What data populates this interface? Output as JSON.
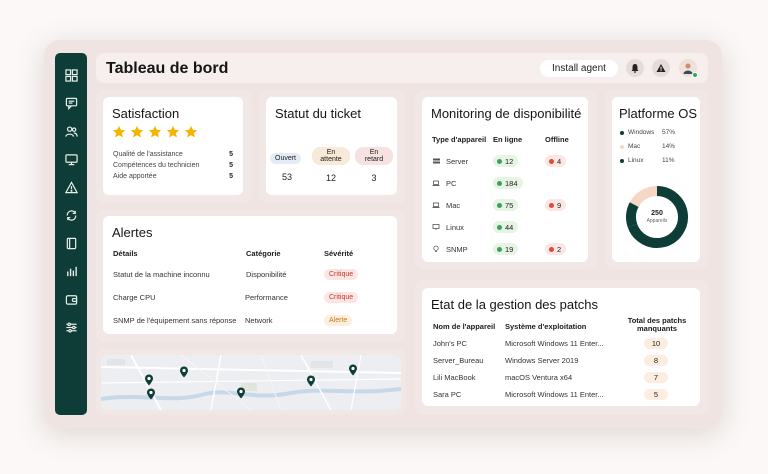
{
  "header": {
    "title": "Tableau de bord",
    "install_label": "Install agent"
  },
  "sidebar": {
    "items": [
      {
        "icon": "grid-icon"
      },
      {
        "icon": "chat-icon"
      },
      {
        "icon": "users-icon"
      },
      {
        "icon": "monitor-icon"
      },
      {
        "icon": "warning-icon"
      },
      {
        "icon": "refresh-icon"
      },
      {
        "icon": "book-icon"
      },
      {
        "icon": "bar-chart-icon"
      },
      {
        "icon": "wallet-icon"
      },
      {
        "icon": "sliders-icon"
      }
    ]
  },
  "satisfaction": {
    "title": "Satisfaction",
    "stars": 5,
    "rows": [
      {
        "label": "Qualité de l'assistance",
        "value": "5"
      },
      {
        "label": "Compétences du technicien",
        "value": "5"
      },
      {
        "label": "Aide apportée",
        "value": "5"
      }
    ]
  },
  "ticket": {
    "title": "Statut du ticket",
    "columns": [
      {
        "label": "Ouvert",
        "value": "53",
        "color": "#e3ecf6"
      },
      {
        "label": "En attente",
        "value": "12",
        "color": "#f8ead8"
      },
      {
        "label": "En retard",
        "value": "3",
        "color": "#f6e3e1"
      }
    ]
  },
  "availability": {
    "title": "Monitoring de disponibilité",
    "headers": [
      "Type d'appareil",
      "En ligne",
      "Offline"
    ],
    "rows": [
      {
        "name": "Server",
        "icon": "server-icon",
        "online": "12",
        "offline": "4"
      },
      {
        "name": "PC",
        "icon": "laptop-icon",
        "online": "184",
        "offline": ""
      },
      {
        "name": "Mac",
        "icon": "laptop-icon",
        "online": "75",
        "offline": "9"
      },
      {
        "name": "Linux",
        "icon": "monitor-small-icon",
        "online": "44",
        "offline": ""
      },
      {
        "name": "SNMP",
        "icon": "bulb-icon",
        "online": "19",
        "offline": "2"
      }
    ]
  },
  "os": {
    "title": "Platforme OS",
    "center_value": "250",
    "center_label": "Appareils",
    "legend": [
      {
        "name": "Windows",
        "pct": "57%",
        "color": "#0e3c36"
      },
      {
        "name": "Mac",
        "pct": "14%",
        "color": "#f6d7c3"
      },
      {
        "name": "Linux",
        "pct": "11%",
        "color": "#0e3c36"
      }
    ],
    "chart_data": {
      "type": "pie",
      "categories": [
        "Windows",
        "Mac",
        "Linux"
      ],
      "values": [
        57,
        14,
        11
      ]
    }
  },
  "alerts": {
    "title": "Alertes",
    "headers": [
      "Détails",
      "Catégorie",
      "Sévérité"
    ],
    "rows": [
      {
        "detail": "Statut de la machine inconnu",
        "category": "Disponibilité",
        "severity": "Critique",
        "sev_color": "#fbe6e4",
        "sev_text": "#c0392b"
      },
      {
        "detail": "Charge CPU",
        "category": "Performance",
        "severity": "Critique",
        "sev_color": "#fbe6e4",
        "sev_text": "#c0392b"
      },
      {
        "detail": "SNMP de l'équipement sans réponse",
        "category": "Network",
        "severity": "Alerte",
        "sev_color": "#fcefdd",
        "sev_text": "#c77a1a"
      }
    ]
  },
  "patches": {
    "title": "Etat de la gestion des patchs",
    "headers": [
      "Nom de l'appareil",
      "Système d'exploitation",
      "Total des patchs",
      "manquants"
    ],
    "rows": [
      {
        "device": "John's PC",
        "os": "Microsoft Windows 11 Enter...",
        "count": "10"
      },
      {
        "device": "Server_Bureau",
        "os": "Windows Server 2019",
        "count": "8"
      },
      {
        "device": "Lili MacBook",
        "os": "macOS Ventura x64",
        "count": "7"
      },
      {
        "device": "Sara PC",
        "os": "Microsoft Windows 11 Enter...",
        "count": "5"
      }
    ]
  }
}
